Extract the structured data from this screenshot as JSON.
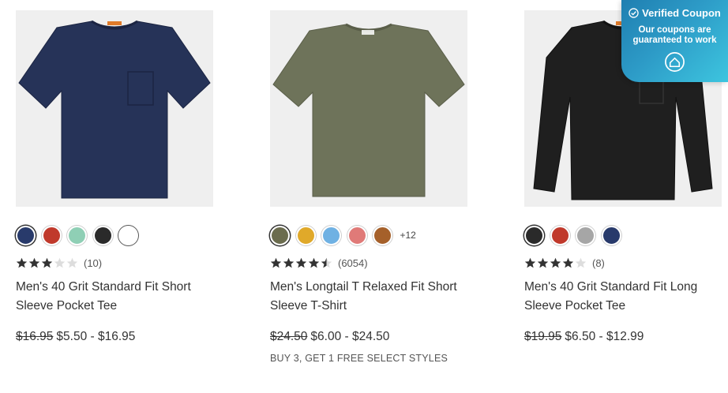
{
  "products": [
    {
      "name": "Men's 40 Grit Standard Fit Short Sleeve Pocket Tee",
      "image_color": "#273459",
      "swatches": [
        "#283a6b",
        "#c0392b",
        "#8fcfb5",
        "#2a2a2a",
        "#ffffff"
      ],
      "selected_swatch": 0,
      "more_colors": "",
      "rating": 3,
      "review_count": "(10)",
      "old_price": "$16.95",
      "price": "$5.50 - $16.95",
      "promo": ""
    },
    {
      "name": "Men's Longtail T Relaxed Fit Short Sleeve T-Shirt",
      "image_color": "#6e735a",
      "swatches": [
        "#6b6c4e",
        "#e0a92a",
        "#6fb1e3",
        "#e07a78",
        "#a5602a"
      ],
      "selected_swatch": 0,
      "more_colors": "+12",
      "rating": 4.5,
      "review_count": "(6054)",
      "old_price": "$24.50",
      "price": "$6.00 - $24.50",
      "promo": "BUY 3, GET 1 FREE SELECT STYLES"
    },
    {
      "name": "Men's 40 Grit Standard Fit Long Sleeve Pocket Tee",
      "image_color": "#1f1f1f",
      "swatches": [
        "#2a2a2a",
        "#c0392b",
        "#a6a6a6",
        "#283a6b"
      ],
      "selected_swatch": 0,
      "more_colors": "",
      "rating": 4,
      "review_count": "(8)",
      "old_price": "$19.95",
      "price": "$6.50 - $12.99",
      "promo": ""
    }
  ],
  "coupon_widget": {
    "title": "Verified Coupon",
    "subtitle": "Our coupons are guaranteed to work",
    "title_icon": "check-circle-icon",
    "bottom_icon": "home-badge-icon"
  }
}
